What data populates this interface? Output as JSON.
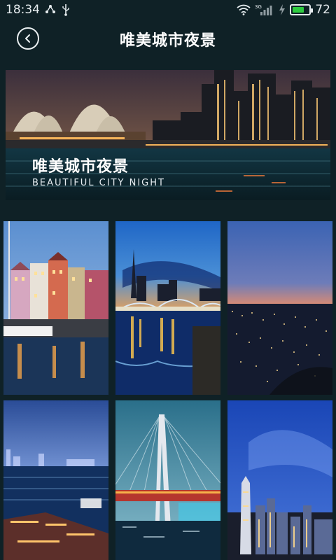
{
  "status_bar": {
    "time": "18:34",
    "battery_percent": 72,
    "battery_label": "72",
    "network_label": "3G"
  },
  "header": {
    "title": "唯美城市夜景"
  },
  "banner": {
    "title_cn": "唯美城市夜景",
    "title_en": "BEAUTIFUL CITY NIGHT"
  },
  "gallery": {
    "tiles": [
      {
        "name": "nyhavn-canal-tile"
      },
      {
        "name": "bridge-reflection-tile"
      },
      {
        "name": "city-lights-aerial-tile"
      },
      {
        "name": "harbor-panorama-tile"
      },
      {
        "name": "cable-bridge-tile"
      },
      {
        "name": "skyscraper-skyline-tile"
      }
    ]
  },
  "colors": {
    "background": "#0f2126",
    "battery_fill": "#2ecc40"
  }
}
